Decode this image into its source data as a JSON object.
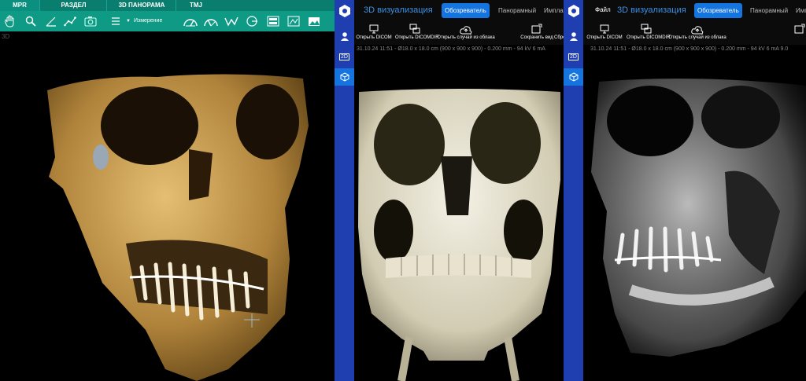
{
  "mpr_app": {
    "tabs": [
      "MPR",
      "РАЗДЕЛ",
      "3D ПАНОРАМА",
      "TMJ"
    ],
    "measure_dropdown": "Измерение",
    "index_label": "3D",
    "tab_active_color": "#0a7e6e",
    "toolbar_color": "#0f9a86"
  },
  "viewer_center": {
    "title": "3D визуализация",
    "tabs": [
      "Обозреватель",
      "Панорамный",
      "Импла"
    ],
    "active_tab": "Обозреватель",
    "toolbar": [
      "Открыть DICOM",
      "Открыть DICOMDIR",
      "Открыть случай из облака",
      "Сохранить вид",
      "Сброс"
    ],
    "info_line": "31.10.24 11:51 - Ø18.0 x 18.0 cm (900 x 900 x 900) - 0.200 mm - 94 kV 6 mA",
    "sidebar": [
      "user-icon",
      "2D",
      "3d-cube-icon"
    ],
    "accent": "#1474e0",
    "sidebar_color": "#1f3fb0"
  },
  "viewer_right": {
    "file_menu": "Файл",
    "title": "3D визуализация",
    "tabs": [
      "Обозреватель",
      "Панорамный",
      "Импла"
    ],
    "active_tab": "Обозреватель",
    "toolbar": [
      "Открыть DICOM",
      "Открыть DICOMDIR",
      "Открыть случай из облака"
    ],
    "info_line": "31.10.24 11:51 - Ø18.0 x 18.0 cm (900 x 900 x 900) - 0.200 mm - 94 kV 6 mA 9.0",
    "sidebar": [
      "user-icon",
      "2D",
      "3d-cube-icon"
    ]
  }
}
